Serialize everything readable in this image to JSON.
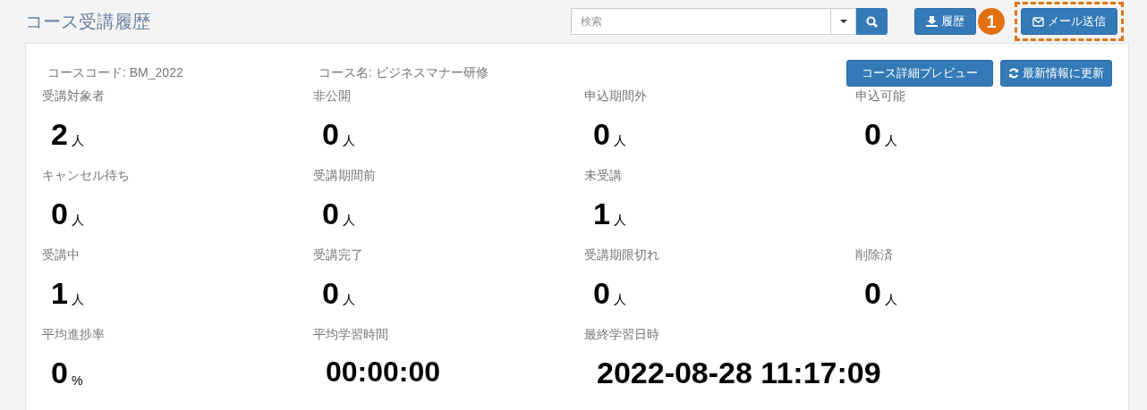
{
  "page_title": "コース受講履歴",
  "search": {
    "placeholder": "検索"
  },
  "toolbar_buttons": [
    {
      "label": "履歴",
      "highlighted": false
    },
    {
      "label": "メール送信",
      "highlighted": true
    }
  ],
  "step_badge": "1",
  "course": {
    "code": "コースコード: BM_2022",
    "name": "コース名: ビジネスマナー研修"
  },
  "course_buttons": [
    {
      "label": "コース詳細プレビュー"
    },
    {
      "label": "最新情報に更新"
    }
  ],
  "stat_rows": [
    [
      {
        "kind": "stat",
        "label": "受講対象者",
        "value": "2",
        "unit": "人"
      },
      {
        "kind": "stat",
        "label": "非公開",
        "value": "0",
        "unit": "人"
      },
      {
        "kind": "stat",
        "label": "申込期間外",
        "value": "0",
        "unit": "人"
      },
      {
        "kind": "stat",
        "label": "申込可能",
        "value": "0",
        "unit": "人"
      }
    ],
    [
      {
        "kind": "stat",
        "label": "キャンセル待ち",
        "value": "0",
        "unit": "人"
      },
      {
        "kind": "stat",
        "label": "受講期間前",
        "value": "0",
        "unit": "人"
      },
      {
        "kind": "stat",
        "label": "未受講",
        "value": "1",
        "unit": "人"
      },
      {
        "kind": "empty"
      }
    ],
    [
      {
        "kind": "stat",
        "label": "受講中",
        "value": "1",
        "unit": "人"
      },
      {
        "kind": "stat",
        "label": "受講完了",
        "value": "0",
        "unit": "人"
      },
      {
        "kind": "stat",
        "label": "受講期限切れ",
        "value": "0",
        "unit": "人"
      },
      {
        "kind": "stat",
        "label": "削除済",
        "value": "0",
        "unit": "人"
      }
    ],
    [
      {
        "kind": "stat",
        "label": "平均進捗率",
        "value": "0",
        "unit": "%"
      },
      {
        "kind": "time",
        "label": "平均学習時間",
        "value": "00:00:00"
      },
      {
        "kind": "datetime",
        "label": "最終学習日時",
        "value": "2022-08-28 11:17:09"
      }
    ]
  ]
}
